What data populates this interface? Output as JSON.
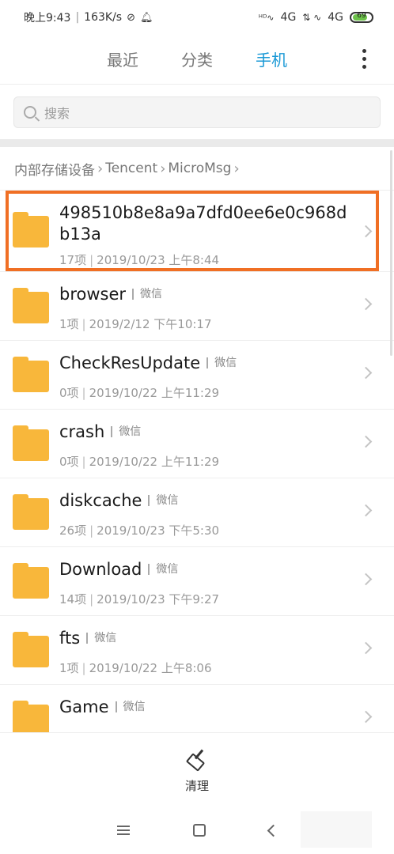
{
  "status": {
    "time": "晚上9:43",
    "speed": "163K/s",
    "network1": "4G",
    "network2": "4G",
    "battery": "69"
  },
  "tabs": [
    {
      "label": "最近"
    },
    {
      "label": "分类"
    },
    {
      "label": "手机"
    }
  ],
  "active_tab": "手机",
  "search": {
    "placeholder": "搜索"
  },
  "breadcrumb": [
    "内部存储设备",
    "Tencent",
    "MicroMsg"
  ],
  "items": [
    {
      "name": "498510b8e8a9a7dfd0ee6e0c968db13a",
      "tag": "",
      "count": "17项",
      "date": "2019/10/23 上午8:44"
    },
    {
      "name": "browser",
      "tag": "微信",
      "count": "1项",
      "date": "2019/2/12 下午10:17"
    },
    {
      "name": "CheckResUpdate",
      "tag": "微信",
      "count": "0项",
      "date": "2019/10/22 上午11:29"
    },
    {
      "name": "crash",
      "tag": "微信",
      "count": "0项",
      "date": "2019/10/22 上午11:29"
    },
    {
      "name": "diskcache",
      "tag": "微信",
      "count": "26项",
      "date": "2019/10/23 下午5:30"
    },
    {
      "name": "Download",
      "tag": "微信",
      "count": "14项",
      "date": "2019/10/23 下午9:27"
    },
    {
      "name": "fts",
      "tag": "微信",
      "count": "1项",
      "date": "2019/10/22 上午8:06"
    },
    {
      "name": "Game",
      "tag": "微信",
      "count": "",
      "date": ""
    }
  ],
  "bottom": {
    "clean_label": "清理"
  },
  "colors": {
    "accent": "#1a99d6",
    "folder": "#f8b73b",
    "highlight": "#f06f24"
  },
  "icons": {
    "folder": "folder-icon",
    "search": "search-icon",
    "clean": "broom-icon"
  }
}
